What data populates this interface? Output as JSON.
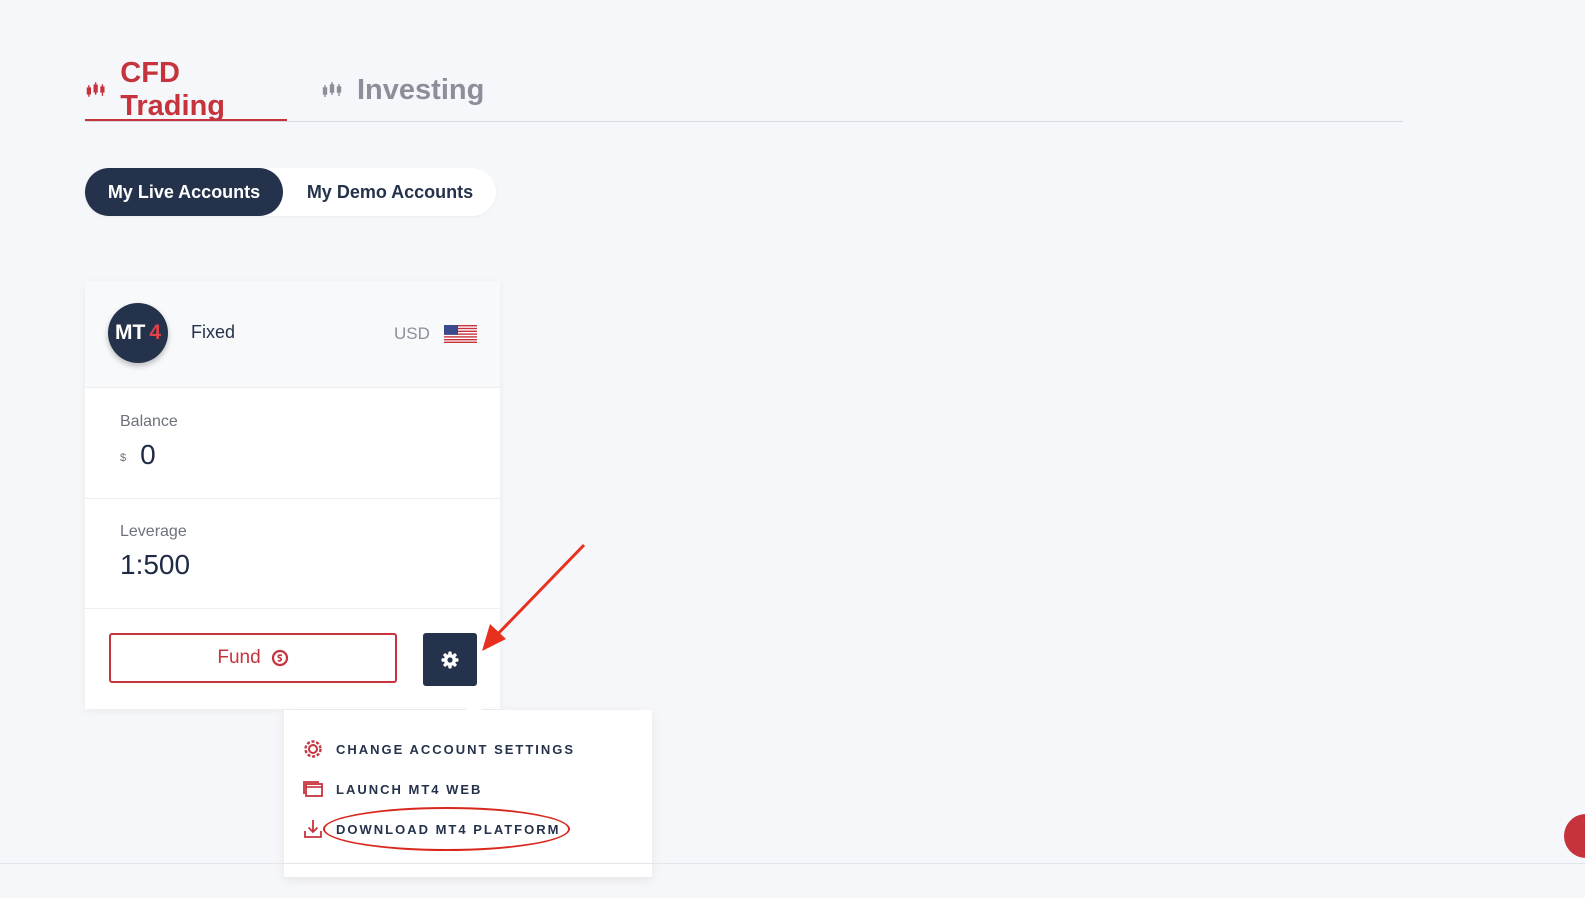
{
  "main_tabs": [
    {
      "label": "CFD Trading",
      "active": true,
      "icon": "candlestick-icon"
    },
    {
      "label": "Investing",
      "active": false,
      "icon": "candlestick-icon"
    }
  ],
  "account_toggle": {
    "live_label": "My Live Accounts",
    "demo_label": "My Demo Accounts",
    "selected": "live"
  },
  "account_card": {
    "platform_logo": {
      "text": "MT",
      "num": "4"
    },
    "account_type": "Fixed",
    "currency": "USD",
    "flag": "us-flag-icon",
    "balance": {
      "label": "Balance",
      "symbol": "$",
      "value": "0"
    },
    "leverage": {
      "label": "Leverage",
      "value": "1:500"
    },
    "fund_label": "Fund",
    "settings_icon": "gear-icon"
  },
  "settings_menu": {
    "items": [
      {
        "label": "CHANGE ACCOUNT SETTINGS",
        "icon": "settings-icon"
      },
      {
        "label": "LAUNCH MT4 WEB",
        "icon": "window-icon"
      },
      {
        "label": "DOWNLOAD MT4 PLATFORM",
        "icon": "download-icon"
      }
    ]
  },
  "colors": {
    "accent_red": "#c7333d",
    "navy": "#25324b",
    "annotation_red": "#d8281e",
    "background": "#f6f7fa"
  }
}
